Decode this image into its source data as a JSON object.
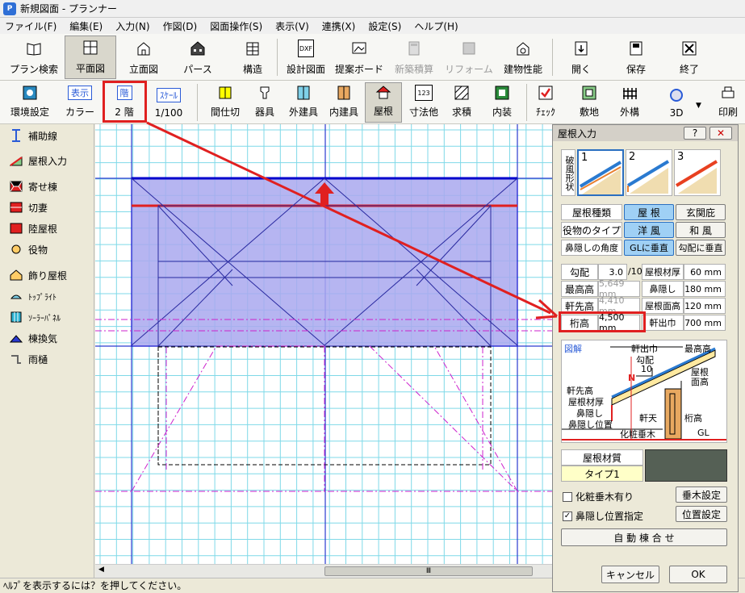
{
  "titlebar": {
    "icon": "P",
    "title": "新規図面 - プランナー"
  },
  "menu": [
    "ファイル(F)",
    "編集(E)",
    "入力(N)",
    "作図(D)",
    "図面操作(S)",
    "表示(V)",
    "連携(X)",
    "設定(S)",
    "ヘルプ(H)"
  ],
  "toolbar1": {
    "plan_search": "プラン検索",
    "floor_plan": "平面図",
    "elevation": "立面図",
    "perspective": "パース",
    "structure": "構造",
    "design_drawing": "設計図面",
    "proposal_board": "提案ボード",
    "new_estimate": "新築積算",
    "reform": "リフォーム",
    "building_perf": "建物性能",
    "open": "開く",
    "save": "保存",
    "exit": "終了",
    "dxf": "DXF"
  },
  "toolbar2": {
    "env_settings": "環境設定",
    "display_box": "表示",
    "color": "カラー",
    "floor_box": "階",
    "floor_value": "2 階",
    "scale_box": "ｽｹｰﾙ",
    "scale_value": "1/100",
    "partition": "間仕切",
    "fixtures": "器具",
    "exterior_fittings": "外建具",
    "interior_fittings": "内建具",
    "roof": "屋根",
    "dimensions": "寸法他",
    "area_calc": "求積",
    "interior": "内装",
    "check": "ﾁｪｯｸ",
    "site": "敷地",
    "exterior": "外構",
    "three_d": "3D",
    "print": "印刷",
    "dim_glyph": "123"
  },
  "sidebar": [
    {
      "label": "補助線",
      "small": false
    },
    {
      "label": "屋根入力",
      "small": false
    },
    {
      "label": "寄せ棟",
      "small": false
    },
    {
      "label": "切妻",
      "small": false
    },
    {
      "label": "陸屋根",
      "small": false
    },
    {
      "label": "役物",
      "small": false
    },
    {
      "label": "飾り屋根",
      "small": false
    },
    {
      "label": "ﾄｯﾌﾟﾗｲﾄ",
      "small": true
    },
    {
      "label": "ｿｰﾗｰﾊﾟﾈﾙ",
      "small": true
    },
    {
      "label": "棟換気",
      "small": false
    },
    {
      "label": "雨樋",
      "small": false
    }
  ],
  "status": "ﾍﾙﾌﾟを表示するには？を押してください。",
  "scrollbar_glyph": "Ⅲ",
  "dialog": {
    "title": "屋根入力",
    "help": "?",
    "close": "✕",
    "gable_label": "破風形状",
    "gable_options": [
      "1",
      "2",
      "3"
    ],
    "roof_type_label": "屋根種類",
    "roof_type_options": [
      "屋 根",
      "玄関庇"
    ],
    "accessory_label": "役物のタイプ",
    "accessory_options": [
      "洋 風",
      "和 風"
    ],
    "fascia_angle_label": "鼻隠しの角度",
    "fascia_angle_options": [
      "GLに垂直",
      "勾配に垂直"
    ],
    "pitch_label": "勾配",
    "pitch_value": "3.0",
    "pitch_unit": "/10",
    "roof_thickness_label": "屋根材厚",
    "roof_thickness_value": "60 mm",
    "max_height_label": "最高高",
    "max_height_value": "5,649 mm",
    "fascia_label": "鼻隠し",
    "fascia_value": "180 mm",
    "eave_height_label": "軒先高",
    "eave_height_value": "4,410 mm",
    "roof_surface_label": "屋根面高",
    "roof_surface_value": "120 mm",
    "beam_height_label": "桁高",
    "beam_height_value": "4,500 mm",
    "eave_width_label": "軒出巾",
    "eave_width_value": "700 mm",
    "diagram": {
      "title": "図解",
      "eave_width": "軒出巾",
      "max_height": "最高高",
      "pitch": "勾配",
      "pitch_num": "10",
      "n": "N",
      "roof_surface": "屋根面高",
      "eave_height": "軒先高",
      "thickness": "屋根材厚",
      "fascia": "鼻隠し",
      "fascia_pos": "鼻隠し位置",
      "soffit": "軒天",
      "beam": "桁高",
      "rafter": "化粧垂木",
      "gl": "GL"
    },
    "material_label": "屋根材質",
    "material_value": "タイプ1",
    "rafter_check": "化粧垂木有り",
    "rafter_btn": "垂木設定",
    "fascia_check": "鼻隠し位置指定",
    "fascia_btn": "位置設定",
    "auto_btn": "自 動 棟 合 せ",
    "cancel": "キャンセル",
    "ok": "OK"
  },
  "colors": {
    "roof_fill": "#a9a8ef",
    "grid": "#7fd9e8",
    "red": "#e02020",
    "blue": "#0000cc",
    "magenta": "#cc22cc"
  }
}
